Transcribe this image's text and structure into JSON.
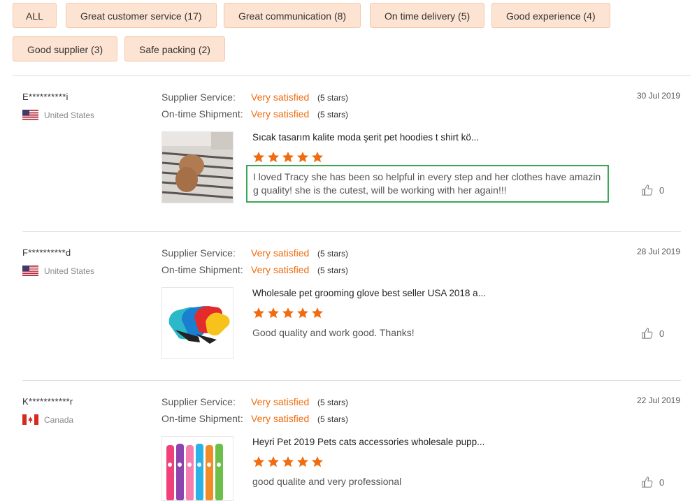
{
  "filters": [
    {
      "label": "ALL"
    },
    {
      "label": "Great customer service (17)"
    },
    {
      "label": "Great communication (8)"
    },
    {
      "label": "On time delivery (5)"
    },
    {
      "label": "Good experience (4)"
    },
    {
      "label": "Good supplier (3)"
    },
    {
      "label": "Safe packing (2)"
    }
  ],
  "reviews": [
    {
      "user": "E**********i",
      "country": "United States",
      "flag": "us-flag",
      "date": "30 Jul 2019",
      "supplier_label": "Supplier Service:",
      "supplier_value": "Very satisfied",
      "supplier_stars": "(5 stars)",
      "shipment_label": "On-time Shipment:",
      "shipment_value": "Very satisfied",
      "shipment_stars": "(5 stars)",
      "product_title": "Sıcak tasarım kalite moda şerit pet hoodies t shirt kö...",
      "rating": 5,
      "comment": "I loved Tracy she has been so helpful in every step and her clothes have amazing quality! she is the cutest, will be working with her again!!!",
      "likes": "0"
    },
    {
      "user": "F**********d",
      "country": "United States",
      "flag": "us-flag",
      "date": "28 Jul 2019",
      "supplier_label": "Supplier Service:",
      "supplier_value": "Very satisfied",
      "supplier_stars": "(5 stars)",
      "shipment_label": "On-time Shipment:",
      "shipment_value": "Very satisfied",
      "shipment_stars": "(5 stars)",
      "product_title": "Wholesale pet grooming glove best seller USA 2018 a...",
      "rating": 5,
      "comment": "Good quality and work good. Thanks!",
      "likes": "0"
    },
    {
      "user": "K***********r",
      "country": "Canada",
      "flag": "ca-flag",
      "date": "22 Jul 2019",
      "supplier_label": "Supplier Service:",
      "supplier_value": "Very satisfied",
      "supplier_stars": "(5 stars)",
      "shipment_label": "On-time Shipment:",
      "shipment_value": "Very satisfied",
      "shipment_stars": "(5 stars)",
      "product_title": "Heyri Pet 2019 Pets cats accessories wholesale pupp...",
      "rating": 5,
      "comment": "good qualite and very professional",
      "likes": "0"
    }
  ],
  "colors": {
    "accent": "#f06c10",
    "tag_bg": "#fde3d2",
    "highlight_border": "#3aa757"
  }
}
